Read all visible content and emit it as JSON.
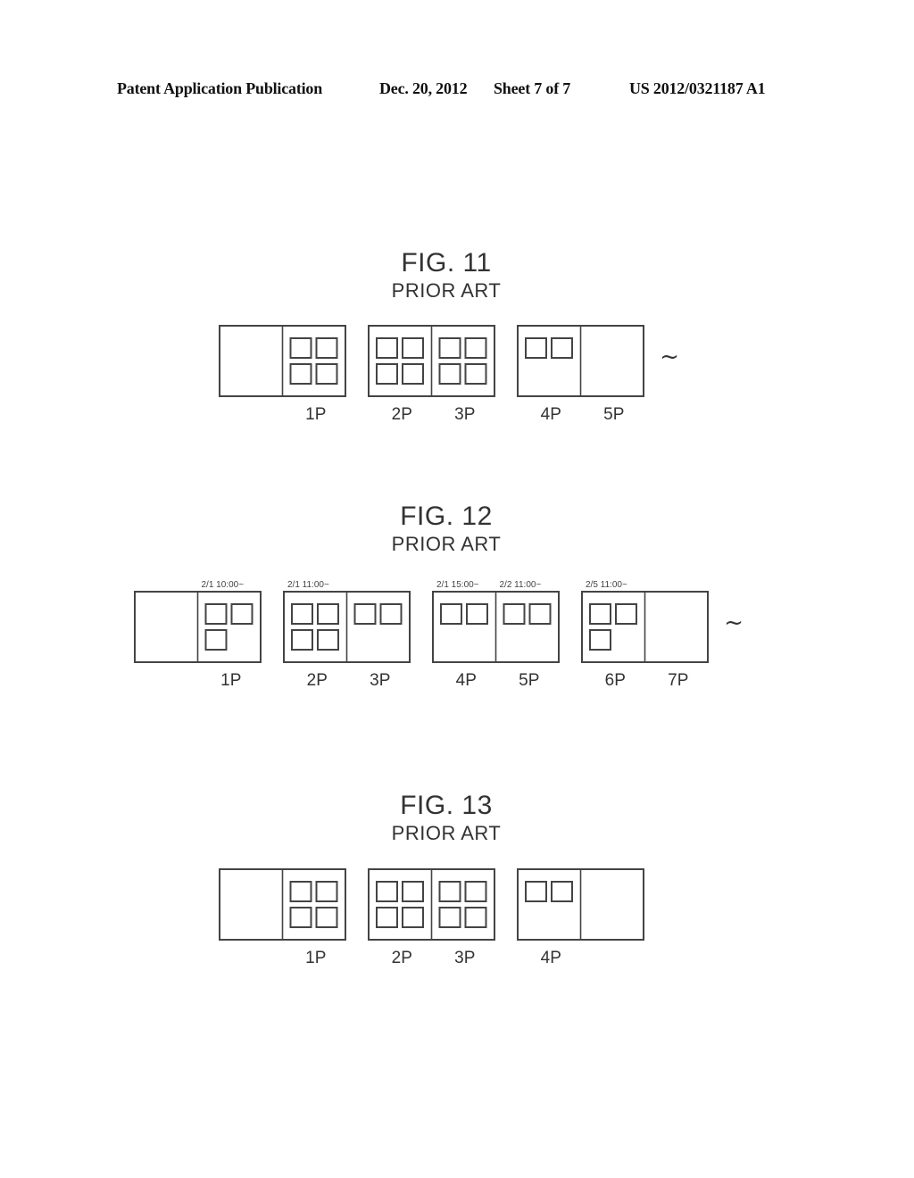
{
  "header": {
    "publication": "Patent Application Publication",
    "date": "Dec. 20, 2012",
    "sheet": "Sheet 7 of 7",
    "number": "US 2012/0321187 A1"
  },
  "figures": [
    {
      "id": "fig11",
      "title": "FIG. 11",
      "subtitle": "PRIOR ART",
      "continues": true,
      "continuation_symbol": "~",
      "spreads": [
        {
          "left": {
            "photos": 0
          },
          "right": {
            "photos": 4,
            "label": "1P"
          }
        },
        {
          "left": {
            "photos": 4,
            "label": "2P"
          },
          "right": {
            "photos": 4,
            "label": "3P"
          }
        },
        {
          "left": {
            "photos": 2,
            "label": "4P"
          },
          "right": {
            "photos": 0,
            "label": "5P"
          }
        }
      ]
    },
    {
      "id": "fig12",
      "title": "FIG. 12",
      "subtitle": "PRIOR ART",
      "continues": true,
      "continuation_symbol": "~",
      "spreads": [
        {
          "left": {
            "photos": 0
          },
          "right": {
            "photos": 3,
            "label": "1P",
            "timestamp": "2/1 10:00~"
          }
        },
        {
          "left": {
            "photos": 4,
            "label": "2P",
            "timestamp": "2/1 11:00~"
          },
          "right": {
            "photos": 2,
            "label": "3P"
          }
        },
        {
          "left": {
            "photos": 2,
            "label": "4P",
            "timestamp": "2/1 15:00~"
          },
          "right": {
            "photos": 2,
            "label": "5P",
            "timestamp": "2/2 11:00~"
          }
        },
        {
          "left": {
            "photos": 3,
            "label": "6P",
            "timestamp": "2/5 11:00~"
          },
          "right": {
            "photos": 0,
            "label": "7P"
          }
        }
      ]
    },
    {
      "id": "fig13",
      "title": "FIG. 13",
      "subtitle": "PRIOR ART",
      "continues": false,
      "spreads": [
        {
          "left": {
            "photos": 0
          },
          "right": {
            "photos": 4,
            "label": "1P"
          }
        },
        {
          "left": {
            "photos": 4,
            "label": "2P"
          },
          "right": {
            "photos": 4,
            "label": "3P"
          }
        },
        {
          "left": {
            "photos": 2,
            "label": "4P"
          },
          "right": {
            "photos": 0
          }
        }
      ]
    }
  ]
}
